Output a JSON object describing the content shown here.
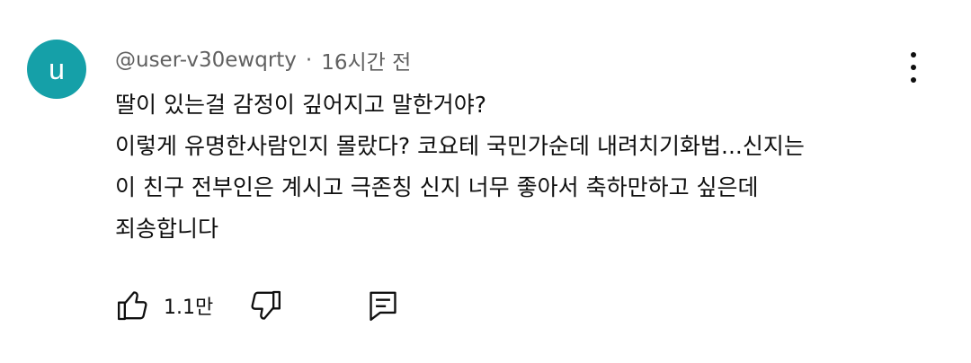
{
  "colors": {
    "avatar_bg": "#15a0a8",
    "meta_text": "#606060",
    "body_text": "#0f0f0f"
  },
  "comment": {
    "avatar_letter": "u",
    "handle": "@user-v30ewqrty",
    "separator": "·",
    "time": "16시간 전",
    "lines": [
      "딸이 있는걸 감정이 깊어지고 말한거야?",
      "이렇게 유명한사람인지 몰랐다? 코요테 국민가순데 내려치기화법...신지는",
      "이 친구 전부인은 계시고 극존칭 신지 너무 좋아서 축하만하고 싶은데",
      "죄송합니다"
    ],
    "like_count": "1.1만"
  },
  "icons": {
    "menu": "more-vertical-icon",
    "like": "thumbs-up-icon",
    "dislike": "thumbs-down-icon",
    "reply": "comment-icon"
  }
}
